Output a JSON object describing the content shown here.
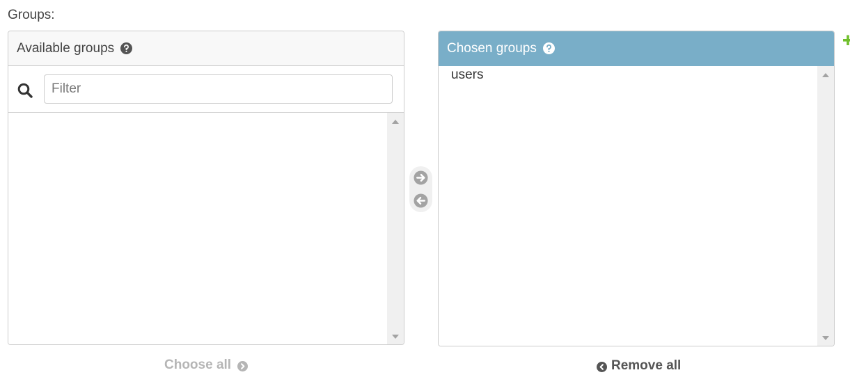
{
  "field": {
    "label": "Groups:"
  },
  "available": {
    "title": "Available groups",
    "filter_placeholder": "Filter",
    "filter_value": "",
    "items": []
  },
  "chosen": {
    "title": "Chosen groups",
    "items": [
      "users"
    ]
  },
  "actions": {
    "choose_all": "Choose all",
    "remove_all": "Remove all"
  },
  "icons": {
    "help": "help-circle-icon",
    "search": "search-icon",
    "add": "arrow-right-circle-icon",
    "remove": "arrow-left-circle-icon",
    "add_related": "plus-icon"
  },
  "colors": {
    "chosen_header": "#79aec8",
    "add_related": "#70bf2b",
    "disabled_action": "#b5b5b5",
    "active_action": "#555555"
  }
}
